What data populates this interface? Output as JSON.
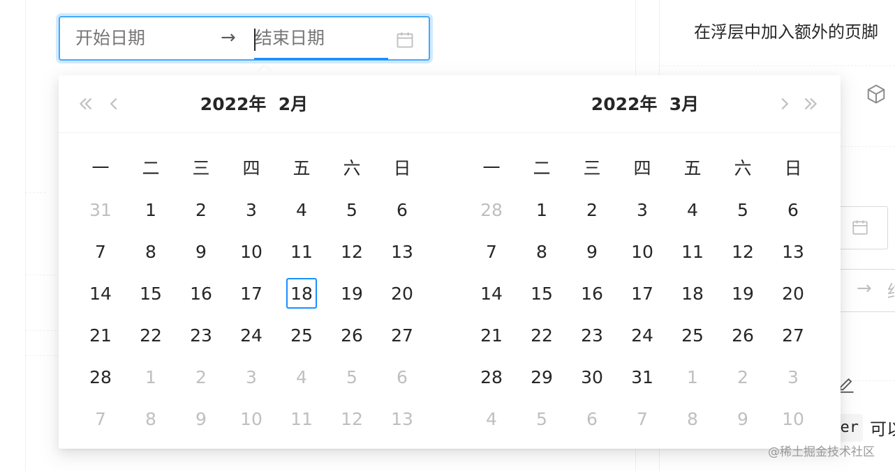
{
  "range_picker": {
    "start_placeholder": "开始日期",
    "end_placeholder": "结束日期",
    "separator": "→"
  },
  "calendars": [
    {
      "title": "2022年  2月",
      "weekdays": [
        "一",
        "二",
        "三",
        "四",
        "五",
        "六",
        "日"
      ],
      "weeks": [
        [
          {
            "d": "31",
            "m": true
          },
          {
            "d": "1"
          },
          {
            "d": "2"
          },
          {
            "d": "3"
          },
          {
            "d": "4"
          },
          {
            "d": "5"
          },
          {
            "d": "6"
          }
        ],
        [
          {
            "d": "7"
          },
          {
            "d": "8"
          },
          {
            "d": "9"
          },
          {
            "d": "10"
          },
          {
            "d": "11"
          },
          {
            "d": "12"
          },
          {
            "d": "13"
          }
        ],
        [
          {
            "d": "14"
          },
          {
            "d": "15"
          },
          {
            "d": "16"
          },
          {
            "d": "17"
          },
          {
            "d": "18",
            "today": true
          },
          {
            "d": "19"
          },
          {
            "d": "20"
          }
        ],
        [
          {
            "d": "21"
          },
          {
            "d": "22"
          },
          {
            "d": "23"
          },
          {
            "d": "24"
          },
          {
            "d": "25"
          },
          {
            "d": "26"
          },
          {
            "d": "27"
          }
        ],
        [
          {
            "d": "28"
          },
          {
            "d": "1",
            "m": true
          },
          {
            "d": "2",
            "m": true
          },
          {
            "d": "3",
            "m": true
          },
          {
            "d": "4",
            "m": true
          },
          {
            "d": "5",
            "m": true
          },
          {
            "d": "6",
            "m": true
          }
        ],
        [
          {
            "d": "7",
            "m": true
          },
          {
            "d": "8",
            "m": true
          },
          {
            "d": "9",
            "m": true
          },
          {
            "d": "10",
            "m": true
          },
          {
            "d": "11",
            "m": true
          },
          {
            "d": "12",
            "m": true
          },
          {
            "d": "13",
            "m": true
          }
        ]
      ]
    },
    {
      "title": "2022年  3月",
      "weekdays": [
        "一",
        "二",
        "三",
        "四",
        "五",
        "六",
        "日"
      ],
      "weeks": [
        [
          {
            "d": "28",
            "m": true
          },
          {
            "d": "1"
          },
          {
            "d": "2"
          },
          {
            "d": "3"
          },
          {
            "d": "4"
          },
          {
            "d": "5"
          },
          {
            "d": "6"
          }
        ],
        [
          {
            "d": "7"
          },
          {
            "d": "8"
          },
          {
            "d": "9"
          },
          {
            "d": "10"
          },
          {
            "d": "11"
          },
          {
            "d": "12"
          },
          {
            "d": "13"
          }
        ],
        [
          {
            "d": "14"
          },
          {
            "d": "15"
          },
          {
            "d": "16"
          },
          {
            "d": "17"
          },
          {
            "d": "18"
          },
          {
            "d": "19"
          },
          {
            "d": "20"
          }
        ],
        [
          {
            "d": "21"
          },
          {
            "d": "22"
          },
          {
            "d": "23"
          },
          {
            "d": "24"
          },
          {
            "d": "25"
          },
          {
            "d": "26"
          },
          {
            "d": "27"
          }
        ],
        [
          {
            "d": "28"
          },
          {
            "d": "29"
          },
          {
            "d": "30"
          },
          {
            "d": "31"
          },
          {
            "d": "1",
            "m": true
          },
          {
            "d": "2",
            "m": true
          },
          {
            "d": "3",
            "m": true
          }
        ],
        [
          {
            "d": "4",
            "m": true
          },
          {
            "d": "5",
            "m": true
          },
          {
            "d": "6",
            "m": true
          },
          {
            "d": "7",
            "m": true
          },
          {
            "d": "8",
            "m": true
          },
          {
            "d": "9",
            "m": true
          },
          {
            "d": "10",
            "m": true
          }
        ]
      ]
    }
  ],
  "background": {
    "right_title": "在浮层中加入额外的页脚",
    "right_input_separator": "→",
    "right_input_text": "结",
    "code_chip": "er",
    "right_tail_text": "可以"
  },
  "watermark": "@稀土掘金技术社区",
  "colors": {
    "primary": "#1890ff",
    "muted_text": "#bfbfbf",
    "text": "#262626"
  },
  "icons": {
    "prev_year": "double-chevron-left-icon",
    "prev_month": "chevron-left-icon",
    "next_month": "chevron-right-icon",
    "next_year": "double-chevron-right-icon",
    "calendar": "calendar-icon"
  }
}
